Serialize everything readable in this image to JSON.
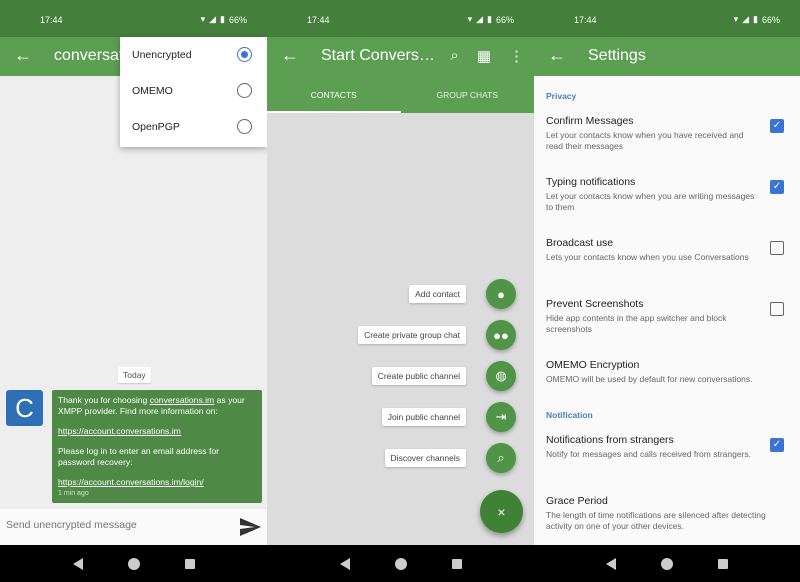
{
  "status": {
    "time": "17:44",
    "battery": "66%"
  },
  "chat": {
    "title": "conversations.im",
    "encryption_menu": [
      {
        "label": "Unencrypted",
        "selected": true
      },
      {
        "label": "OMEMO",
        "selected": false
      },
      {
        "label": "OpenPGP",
        "selected": false
      }
    ],
    "date_divider": "Today",
    "avatar_letter": "C",
    "message": {
      "line1_pre": "Thank you for choosing ",
      "line1_link": "conversations.im",
      "line1_post": " as your XMPP provider. Find more information on:",
      "link1": "https://account.conversations.im",
      "line2": "Please log in to enter an email address for password recovery:",
      "link2": "https://account.conversations.im/login/",
      "time": "1 min ago"
    },
    "input_placeholder": "Send unencrypted message"
  },
  "start": {
    "title": "Start Convers…",
    "tabs": [
      {
        "label": "CONTACTS",
        "active": true
      },
      {
        "label": "GROUP CHATS",
        "active": false
      }
    ],
    "actions": [
      {
        "label": "Add contact",
        "icon": "person-icon"
      },
      {
        "label": "Create private group chat",
        "icon": "group-icon"
      },
      {
        "label": "Create public channel",
        "icon": "globe-icon"
      },
      {
        "label": "Join public channel",
        "icon": "enter-icon"
      },
      {
        "label": "Discover channels",
        "icon": "search-icon"
      }
    ],
    "close_label": "×"
  },
  "settings": {
    "title": "Settings",
    "section_privacy": "Privacy",
    "section_notification": "Notification",
    "prefs": [
      {
        "title": "Confirm Messages",
        "summary": "Let your contacts know when you have received and read their messages",
        "checked": true
      },
      {
        "title": "Typing notifications",
        "summary": "Let your contacts know when you are writing messages to them",
        "checked": true
      },
      {
        "title": "Broadcast use",
        "summary": "Lets your contacts know when you use Conversations",
        "checked": false
      },
      {
        "title": "Prevent Screenshots",
        "summary": "Hide app contents in the app switcher and block screenshots",
        "checked": false
      },
      {
        "title": "OMEMO Encryption",
        "summary": "OMEMO will be used by default for new conversations."
      },
      {
        "title": "Notifications from strangers",
        "summary": "Notify for messages and calls received from strangers.",
        "checked": true
      },
      {
        "title": "Grace Period",
        "summary": "The length of time notifications are silenced after detecting activity on one of your other devices."
      }
    ]
  },
  "colors": {
    "status_bar": "#447f3b",
    "toolbar": "#5c9e52",
    "accent": "#3b73d4",
    "bubble": "#4e8a45"
  }
}
